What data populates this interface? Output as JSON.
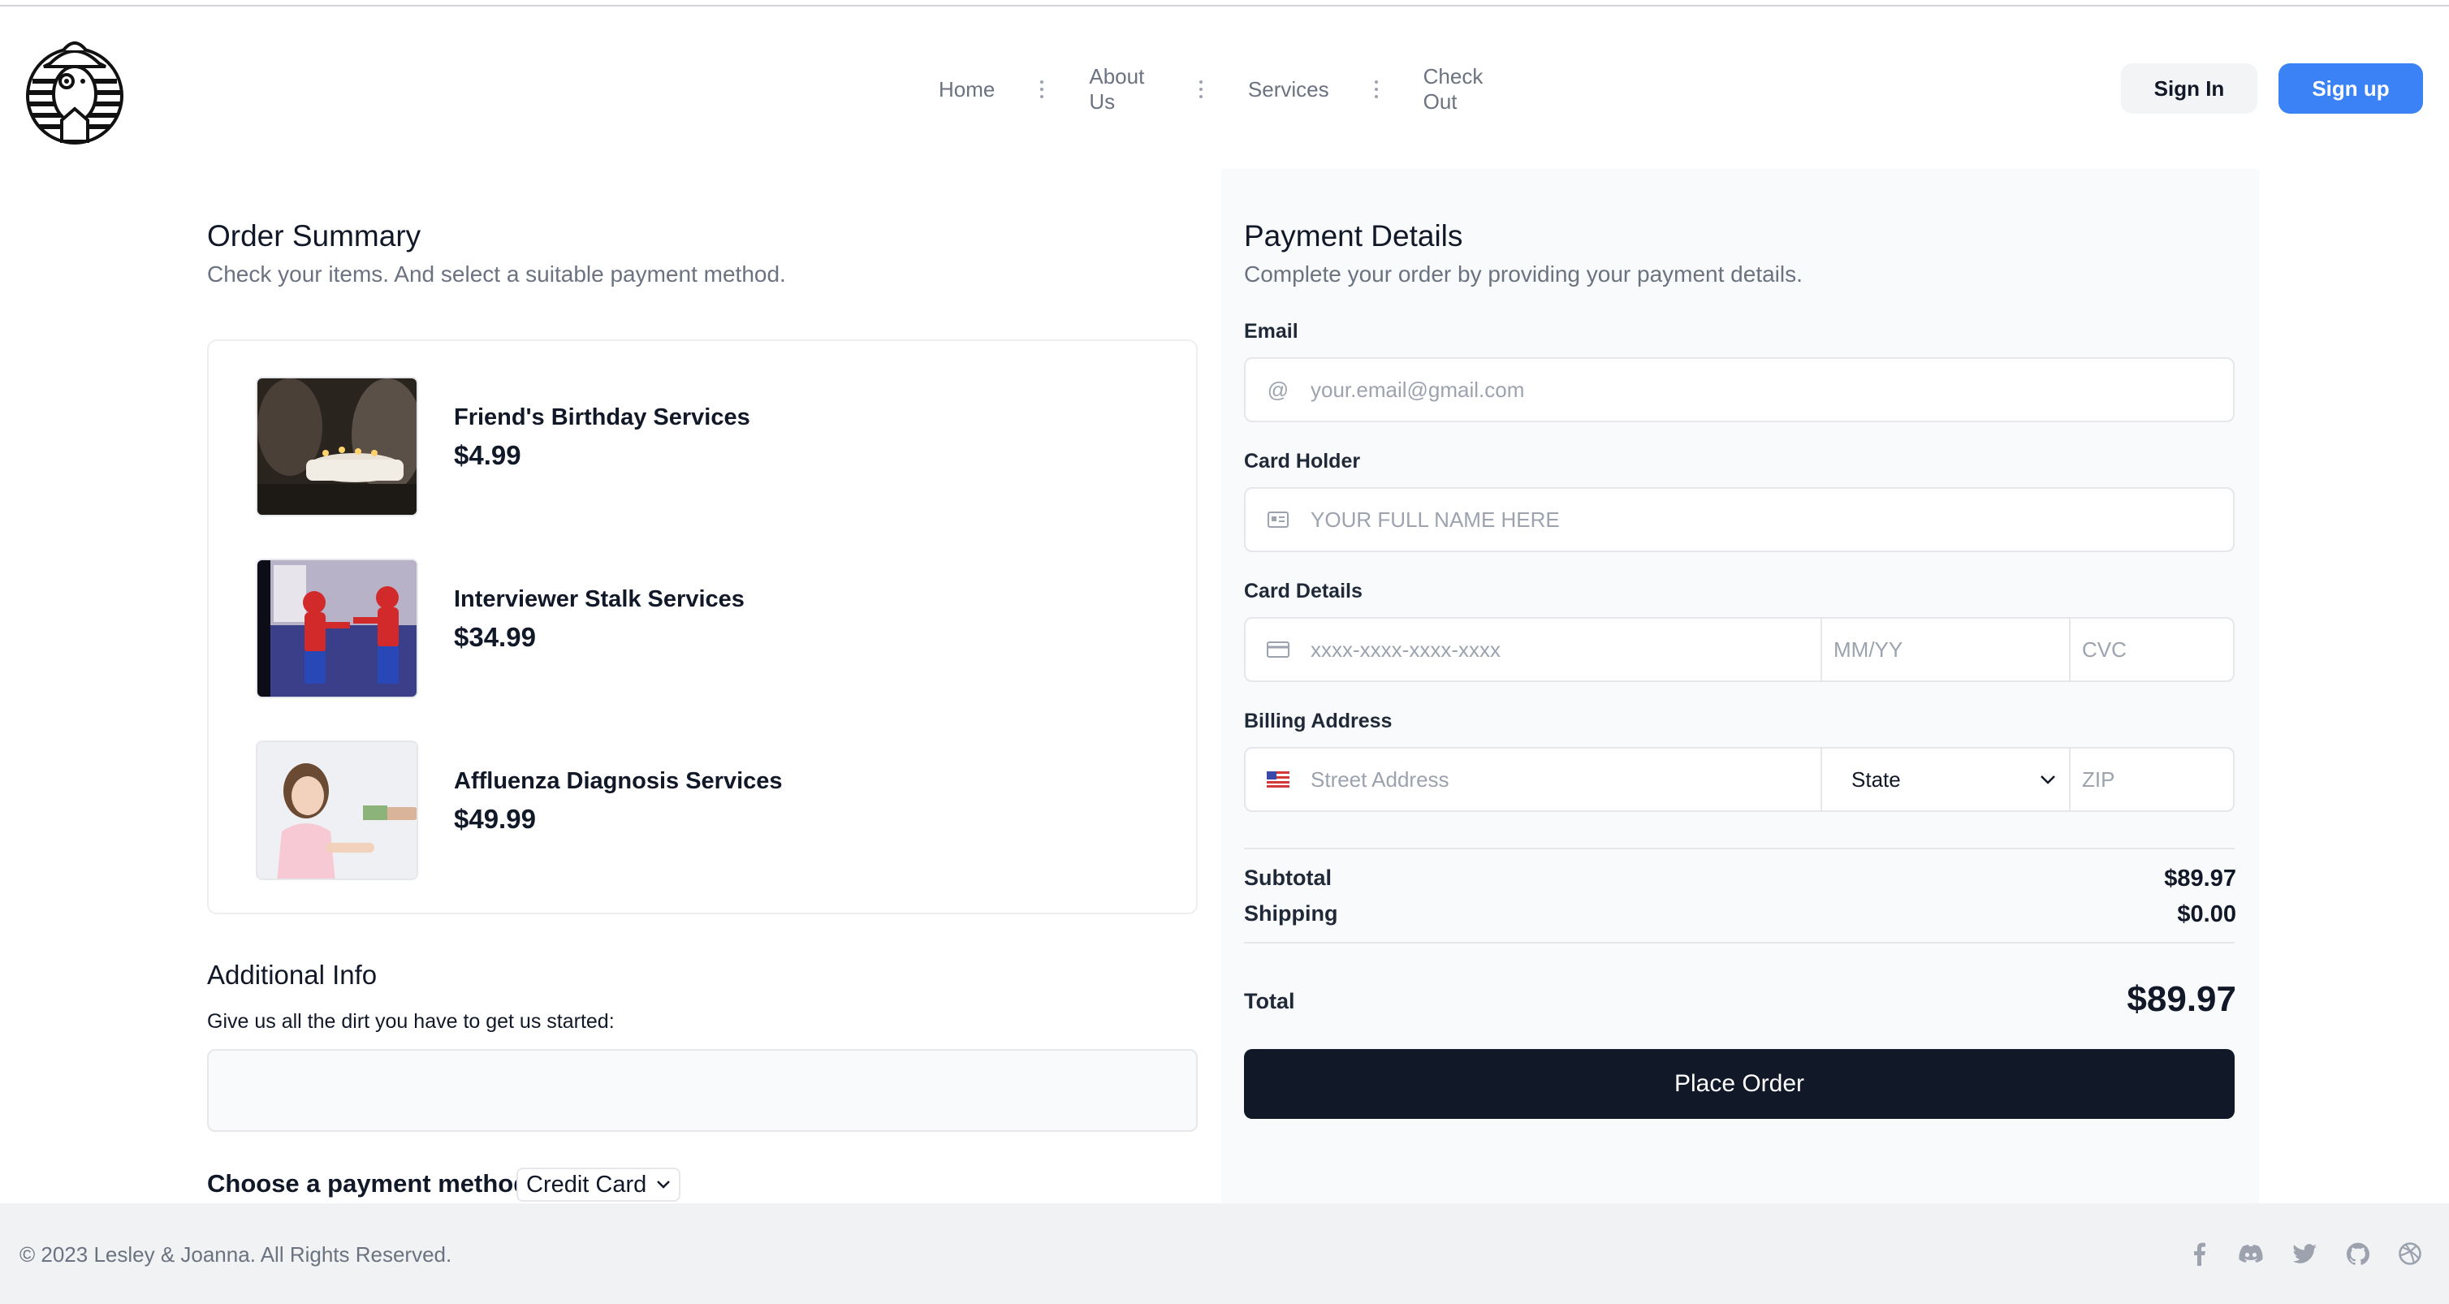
{
  "nav": {
    "items": [
      {
        "label": "Home"
      },
      {
        "label": "About Us"
      },
      {
        "label": "Services"
      },
      {
        "label": "Check Out"
      }
    ],
    "sign_in": "Sign In",
    "sign_up": "Sign up"
  },
  "order_summary": {
    "title": "Order Summary",
    "subtitle": "Check your items. And select a suitable payment method.",
    "items": [
      {
        "name": "Friend's Birthday Services",
        "price": "$4.99",
        "image": "birthday-cake"
      },
      {
        "name": "Interviewer Stalk Services",
        "price": "$34.99",
        "image": "spiderman-pointing"
      },
      {
        "name": "Affluenza Diagnosis Services",
        "price": "$49.99",
        "image": "girl-receiving-money"
      }
    ]
  },
  "additional_info": {
    "title": "Additional Info",
    "label": "Give us all the dirt you have to get us started:",
    "value": ""
  },
  "payment_method": {
    "label": "Choose a payment method:",
    "selected": "Credit Card"
  },
  "payment_details": {
    "title": "Payment Details",
    "subtitle": "Complete your order by providing your payment details.",
    "email_label": "Email",
    "email_placeholder": "your.email@gmail.com",
    "card_holder_label": "Card Holder",
    "card_holder_placeholder": "YOUR FULL NAME HERE",
    "card_details_label": "Card Details",
    "card_number_placeholder": "xxxx-xxxx-xxxx-xxxx",
    "expiry_placeholder": "MM/YY",
    "cvc_placeholder": "CVC",
    "billing_label": "Billing Address",
    "street_placeholder": "Street Address",
    "state_selected": "State",
    "zip_placeholder": "ZIP"
  },
  "totals": {
    "subtotal_label": "Subtotal",
    "subtotal_value": "$89.97",
    "shipping_label": "Shipping",
    "shipping_value": "$0.00",
    "total_label": "Total",
    "total_value": "$89.97"
  },
  "place_order": "Place Order",
  "footer": {
    "copyright": "© 2023 Lesley & Joanna. All Rights Reserved.",
    "social_icons": [
      "facebook-icon",
      "discord-icon",
      "twitter-icon",
      "github-icon",
      "dribbble-icon"
    ]
  },
  "colors": {
    "accent": "#3b82f6",
    "dark_button": "#111827",
    "panel_bg": "#f9fafb",
    "footer_bg": "#f1f2f4"
  }
}
